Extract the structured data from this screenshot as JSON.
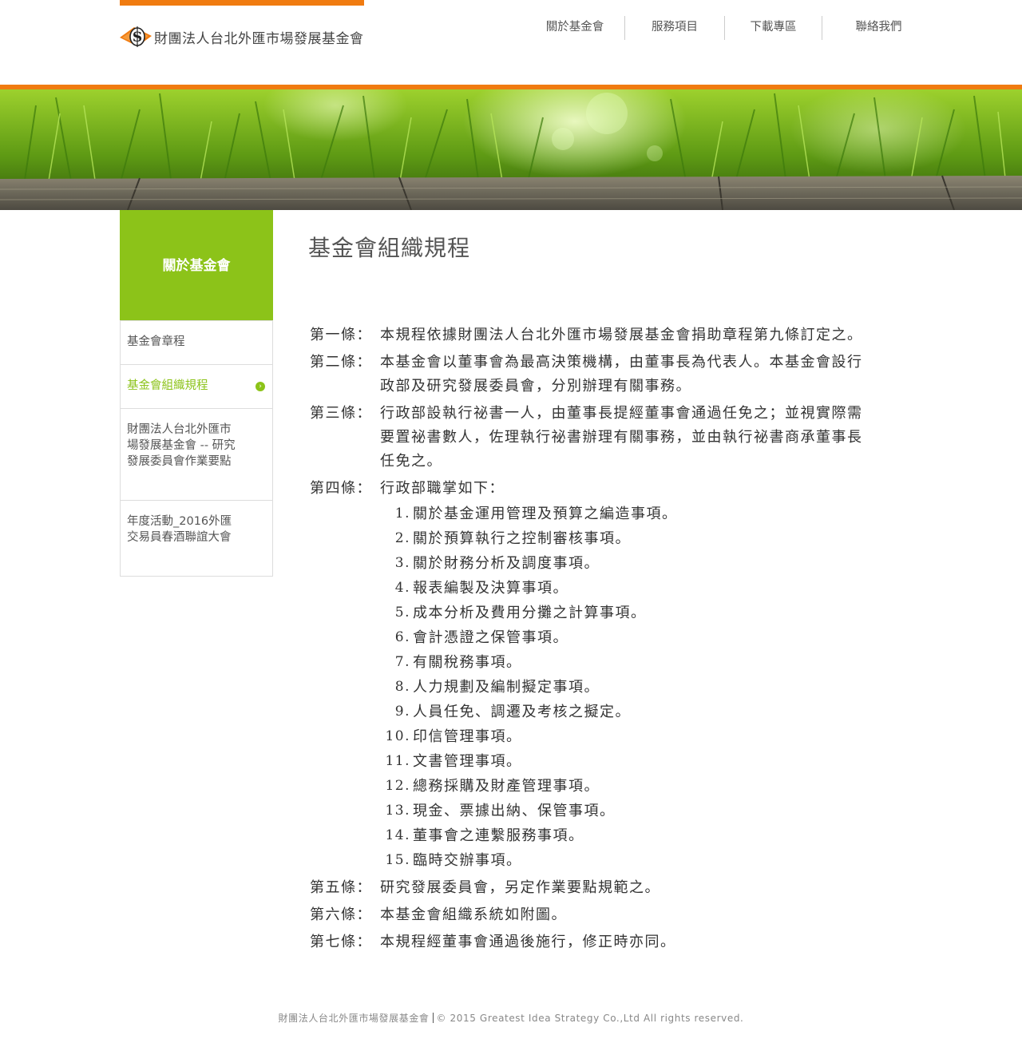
{
  "site": {
    "org_name": "財團法人台北外匯市場發展基金會",
    "logo_icon": "s-coin-logo-icon",
    "brand_orange": "#f07b10",
    "brand_green": "#8cc319"
  },
  "nav": {
    "items": [
      {
        "label": "關於基金會"
      },
      {
        "label": "服務項目"
      },
      {
        "label": "下載專區"
      },
      {
        "label": "聯絡我們"
      }
    ]
  },
  "sidebar": {
    "heading": "關於基金會",
    "items": [
      {
        "label": "基金會章程"
      },
      {
        "label": "基金會組織規程",
        "active": true,
        "icon": "chevron-right-icon"
      },
      {
        "label": "財團法人台北外匯市場發展基金會 -- 研究發展委員會作業要點"
      },
      {
        "label": "年度活動_2016外匯交易員春酒聯誼大會"
      }
    ]
  },
  "main": {
    "title": "基金會組織規程",
    "articles": [
      {
        "num": "第一條：",
        "text": "本規程依據財團法人台北外匯市場發展基金會捐助章程第九條訂定之。"
      },
      {
        "num": "第二條：",
        "text": "本基金會以董事會為最高決策機構，由董事長為代表人。本基金會設行政部及研究發展委員會，分別辦理有關事務。"
      },
      {
        "num": "第三條：",
        "text": "行政部設執行祕書一人，由董事長提經董事會通過任免之；並視實際需要置祕書數人，佐理執行祕書辦理有關事務，並由執行祕書商承董事長任免之。"
      },
      {
        "num": "第四條：",
        "text": "行政部職掌如下："
      },
      {
        "num": "第五條：",
        "text": "研究發展委員會，另定作業要點規範之。"
      },
      {
        "num": "第六條：",
        "text": "本基金會組織系統如附圖。"
      },
      {
        "num": "第七條：",
        "text": "本規程經董事會通過後施行，修正時亦同。"
      }
    ],
    "duties": [
      {
        "num": "1.",
        "text": "關於基金運用管理及預算之編造事項。"
      },
      {
        "num": "2.",
        "text": "關於預算執行之控制審核事項。"
      },
      {
        "num": "3.",
        "text": "關於財務分析及調度事項。"
      },
      {
        "num": "4.",
        "text": "報表編製及決算事項。"
      },
      {
        "num": "5.",
        "text": "成本分析及費用分攤之計算事項。"
      },
      {
        "num": "6.",
        "text": "會計憑證之保管事項。"
      },
      {
        "num": "7.",
        "text": "有關稅務事項。"
      },
      {
        "num": "8.",
        "text": "人力規劃及編制擬定事項。"
      },
      {
        "num": "9.",
        "text": "人員任免、調遷及考核之擬定。"
      },
      {
        "num": "10.",
        "text": "印信管理事項。"
      },
      {
        "num": "11.",
        "text": "文書管理事項。"
      },
      {
        "num": "12.",
        "text": "總務採購及財產管理事項。"
      },
      {
        "num": "13.",
        "text": "現金、票據出納、保管事項。"
      },
      {
        "num": "14.",
        "text": "董事會之連繫服務事項。"
      },
      {
        "num": "15.",
        "text": "臨時交辦事項。"
      }
    ]
  },
  "footer": {
    "org": "財團法人台北外匯市場發展基金會",
    "copyright": "© 2015 Greatest Idea Strategy Co.,Ltd All rights reserved."
  }
}
